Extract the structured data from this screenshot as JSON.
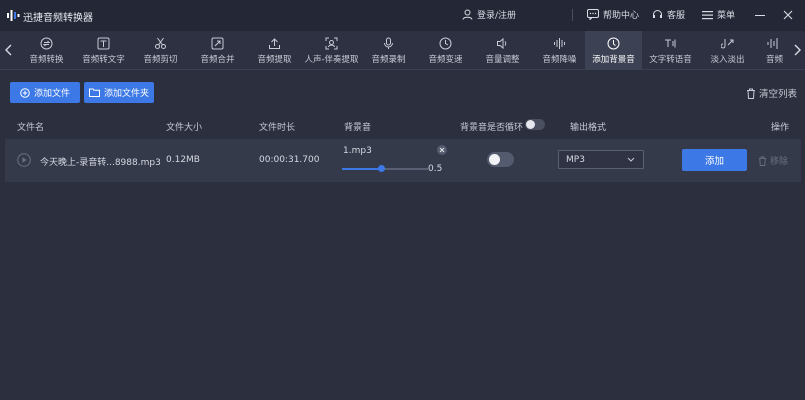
{
  "app": {
    "title": "迅捷音频转换器"
  },
  "titlebar": {
    "login": "登录/注册",
    "help": "帮助中心",
    "support": "客服",
    "menu": "菜单"
  },
  "toolbar": {
    "tools": [
      {
        "label": "音频转换",
        "icon": "audio-convert-icon"
      },
      {
        "label": "音频转文字",
        "icon": "audio-to-text-icon"
      },
      {
        "label": "音频剪切",
        "icon": "scissors-icon"
      },
      {
        "label": "音频合并",
        "icon": "merge-icon"
      },
      {
        "label": "音频提取",
        "icon": "upload-icon"
      },
      {
        "label": "人声-伴奏提取",
        "icon": "vocal-split-icon"
      },
      {
        "label": "音频录制",
        "icon": "microphone-icon"
      },
      {
        "label": "音频变速",
        "icon": "speed-icon"
      },
      {
        "label": "音量调整",
        "icon": "volume-icon"
      },
      {
        "label": "音频降噪",
        "icon": "denoise-icon"
      },
      {
        "label": "添加背景音",
        "icon": "bg-music-icon",
        "active": true
      },
      {
        "label": "文字转语音",
        "icon": "text-to-speech-icon"
      },
      {
        "label": "淡入淡出",
        "icon": "fade-icon"
      },
      {
        "label": "音频",
        "icon": "waveform-icon"
      }
    ]
  },
  "actions": {
    "add_file": "添加文件",
    "add_folder": "添加文件夹",
    "clear_list": "清空列表"
  },
  "table": {
    "headers": {
      "name": "文件名",
      "size": "文件大小",
      "duration": "文件时长",
      "bgm": "背景音",
      "loop": "背景音是否循环",
      "format": "输出格式",
      "ops": "操作"
    },
    "rows": [
      {
        "name": "今天晚上-录音转...8988.mp3",
        "size": "0.12MB",
        "duration": "00:00:31.700",
        "bgm_file": "1.mp3",
        "volume": "0.5",
        "volume_fraction": 0.45,
        "loop": false,
        "format": "MP3",
        "add": "添加",
        "remove": "移除"
      }
    ]
  },
  "colors": {
    "accent": "#3c78e6",
    "bg": "#2b2f3e",
    "titlebar": "#242836"
  }
}
